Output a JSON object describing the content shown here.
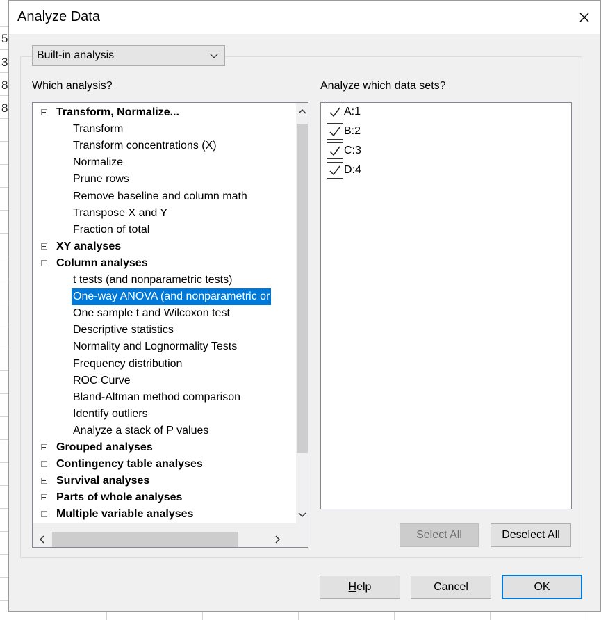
{
  "background_sheet": {
    "cell_values": [
      "5",
      "3",
      "8",
      "8"
    ]
  },
  "dialog": {
    "title": "Analyze Data",
    "close_icon": "close-icon"
  },
  "analysis_type": {
    "selected": "Built-in analysis"
  },
  "which_analysis_label": "Which analysis?",
  "data_sets_label": "Analyze which data sets?",
  "tree": {
    "items": [
      {
        "label": "Transform, Normalize...",
        "kind": "group",
        "expanded": true
      },
      {
        "label": "Transform",
        "kind": "item"
      },
      {
        "label": "Transform concentrations (X)",
        "kind": "item"
      },
      {
        "label": "Normalize",
        "kind": "item"
      },
      {
        "label": "Prune rows",
        "kind": "item"
      },
      {
        "label": "Remove baseline and column math",
        "kind": "item"
      },
      {
        "label": "Transpose X and Y",
        "kind": "item"
      },
      {
        "label": "Fraction of total",
        "kind": "item"
      },
      {
        "label": "XY analyses",
        "kind": "group",
        "expanded": false
      },
      {
        "label": "Column analyses",
        "kind": "group",
        "expanded": true
      },
      {
        "label": "t tests (and nonparametric tests)",
        "kind": "item"
      },
      {
        "label": "One-way ANOVA (and nonparametric or",
        "kind": "item",
        "selected": true
      },
      {
        "label": "One sample t and Wilcoxon test",
        "kind": "item"
      },
      {
        "label": "Descriptive statistics",
        "kind": "item"
      },
      {
        "label": "Normality and Lognormality Tests",
        "kind": "item"
      },
      {
        "label": "Frequency distribution",
        "kind": "item"
      },
      {
        "label": "ROC Curve",
        "kind": "item"
      },
      {
        "label": "Bland-Altman method comparison",
        "kind": "item"
      },
      {
        "label": "Identify outliers",
        "kind": "item"
      },
      {
        "label": "Analyze a stack of P values",
        "kind": "item"
      },
      {
        "label": "Grouped analyses",
        "kind": "group",
        "expanded": false
      },
      {
        "label": "Contingency table analyses",
        "kind": "group",
        "expanded": false
      },
      {
        "label": "Survival analyses",
        "kind": "group",
        "expanded": false
      },
      {
        "label": "Parts of whole analyses",
        "kind": "group",
        "expanded": false
      },
      {
        "label": "Multiple variable analyses",
        "kind": "group",
        "expanded": false
      }
    ]
  },
  "data_sets": [
    {
      "label": "A:1",
      "checked": true
    },
    {
      "label": "B:2",
      "checked": true
    },
    {
      "label": "C:3",
      "checked": true
    },
    {
      "label": "D:4",
      "checked": true
    }
  ],
  "buttons": {
    "select_all": "Select All",
    "deselect_all": "Deselect All",
    "help_prefix": "H",
    "help_rest": "elp",
    "cancel": "Cancel",
    "ok": "OK"
  },
  "colors": {
    "selection": "#0078d7",
    "default_button_border": "#0078d7"
  }
}
